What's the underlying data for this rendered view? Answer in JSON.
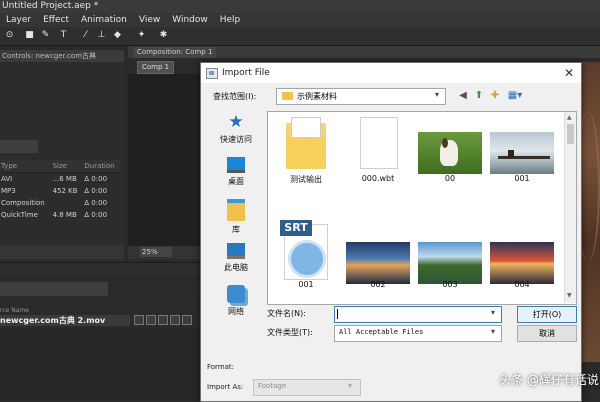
{
  "ae": {
    "title": "Untitled Project.aep *",
    "menu": [
      "Layer",
      "Effect",
      "Animation",
      "View",
      "Window",
      "Help"
    ],
    "project_panel_title": "Controls: newcger.com古典",
    "table_headers": {
      "type": "Type",
      "size": "Size",
      "duration": "Duration"
    },
    "table_rows": [
      {
        "type": "AVI",
        "size": "...6 MB",
        "duration": "Δ 0:00"
      },
      {
        "type": "MP3",
        "size": "452 KB",
        "duration": "Δ 0:00"
      },
      {
        "type": "Composition",
        "size": "",
        "duration": "Δ 0:00"
      },
      {
        "type": "QuickTime",
        "size": "4.8 MB",
        "duration": "Δ 0:00"
      }
    ],
    "composition_tab": "Composition: Comp 1",
    "comp_subtab": "Comp 1",
    "zoom": "25%",
    "timeline_source_header": "rce Name",
    "timeline_source": "newcger.com古典 2.mov"
  },
  "dialog": {
    "title": "Import File",
    "look_in_label": "查找范围(I):",
    "look_in_value": "示例素材料",
    "places": [
      {
        "label": "快速访问",
        "icon": "star-icon"
      },
      {
        "label": "桌面",
        "icon": "desktop-icon"
      },
      {
        "label": "库",
        "icon": "library-icon"
      },
      {
        "label": "此电脑",
        "icon": "computer-icon"
      },
      {
        "label": "网络",
        "icon": "network-icon"
      }
    ],
    "files": [
      {
        "name": "测试输出",
        "kind": "folder"
      },
      {
        "name": "000.wbt",
        "kind": "document"
      },
      {
        "name": "00",
        "kind": "image-dog"
      },
      {
        "name": "001",
        "kind": "image-pier"
      },
      {
        "name": "001",
        "kind": "srt-file"
      },
      {
        "name": "002",
        "kind": "image-lake-sunset"
      },
      {
        "name": "003",
        "kind": "image-lake-green"
      },
      {
        "name": "004",
        "kind": "image-sunset-red"
      }
    ],
    "srt_badge": "SRT",
    "filename_label": "文件名(N):",
    "filename_value": "",
    "filetype_label": "文件类型(T):",
    "filetype_value": "All Acceptable Files",
    "open_label": "打开(O)",
    "cancel_label": "取消",
    "format_label": "Format:",
    "import_as_label": "Import As:",
    "import_as_value": "Footage"
  },
  "watermark": {
    "text": "头条 @辉仔有话说"
  }
}
